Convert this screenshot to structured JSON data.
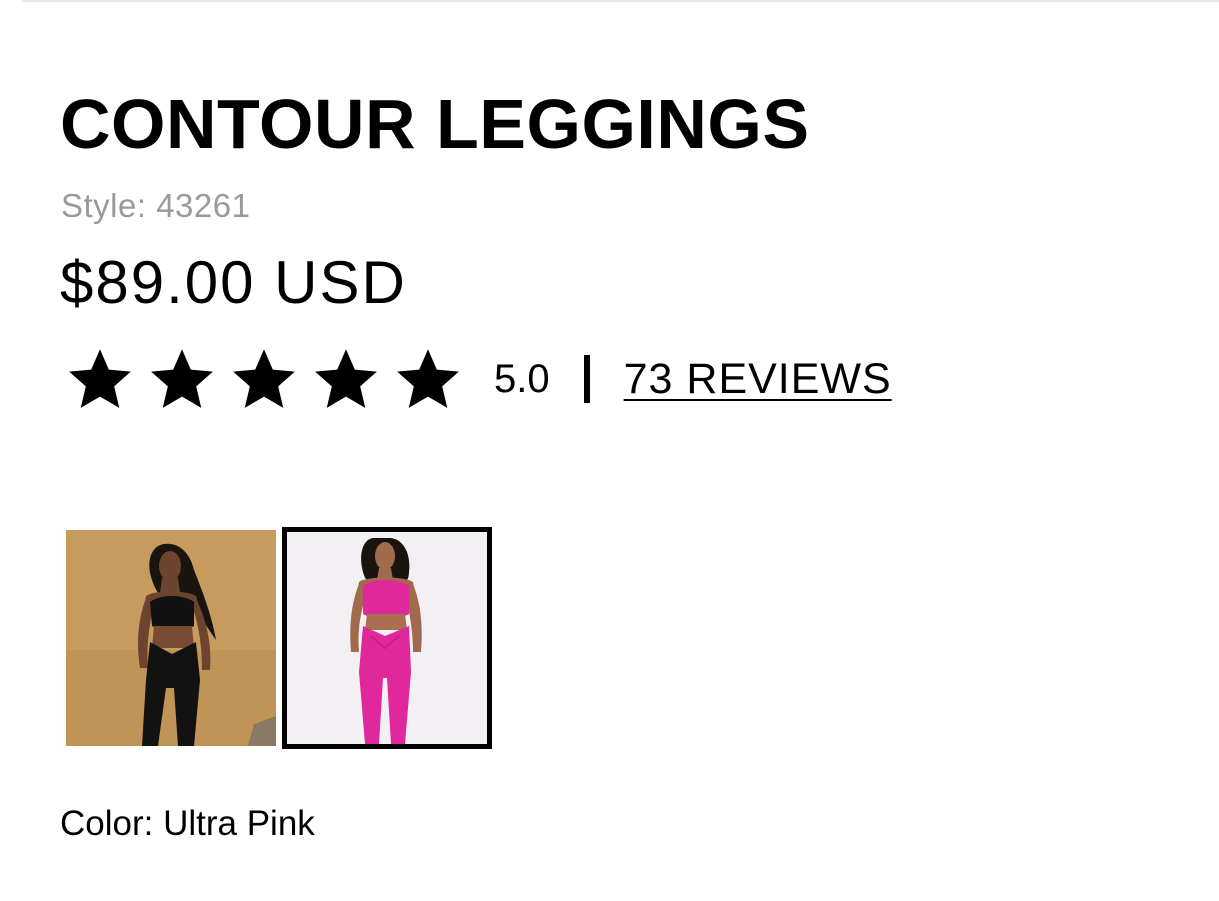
{
  "product": {
    "title": "CONTOUR LEGGINGS",
    "style_line": "Style: 43261",
    "price": "$89.00 USD"
  },
  "rating": {
    "stars_filled": 5,
    "stars_total": 5,
    "value": "5.0",
    "separator": "|",
    "reviews_link": "73 REVIEWS"
  },
  "swatches": [
    {
      "name": "black",
      "selected": false,
      "background": "#c49a5c",
      "garment_color": "#141414"
    },
    {
      "name": "ultra-pink",
      "selected": true,
      "background": "#f2f0f3",
      "garment_color": "#e0279c"
    }
  ],
  "color_selection": {
    "text": "Color: Ultra Pink"
  },
  "colors": {
    "text": "#000000",
    "muted_text": "#9a9a9a",
    "selected_border": "#000000"
  },
  "icons": {
    "star": "star-icon"
  }
}
